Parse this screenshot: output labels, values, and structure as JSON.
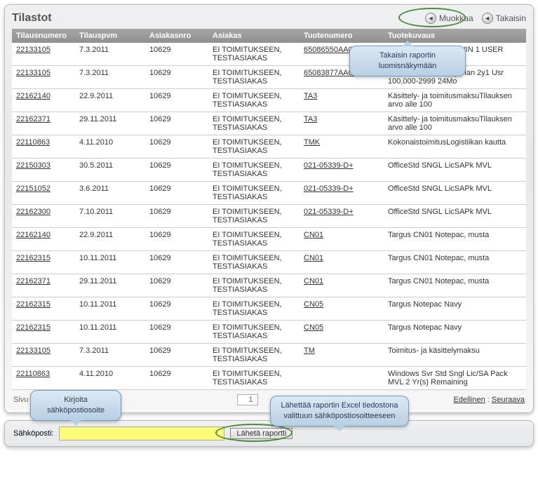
{
  "title": "Tilastot",
  "toolbar": {
    "edit": "Muokkaa",
    "back": "Takaisin"
  },
  "columns": {
    "ordernum": "Tilausnumero",
    "orderdate": "Tilauspvm",
    "custnum": "Asiakasnro",
    "customer": "Asiakas",
    "prodnum": "Tuotenumero",
    "proddesc": "Tuotekuvaus"
  },
  "rows": [
    {
      "ordernum": "22133105",
      "orderdate": "7.3.2011",
      "custnum": "10629",
      "customer": "EI TOIMITUKSEEN, TESTIASIAKAS",
      "prodnum": "65086550AA02A00",
      "proddesc": "Acrobat 10 SF AOO WIN 1 USER"
    },
    {
      "ordernum": "22133105",
      "orderdate": "7.3.2011",
      "custnum": "10629",
      "customer": "EI TOIMITUKSEEN, TESTIASIAKAS",
      "prodnum": "65083877AA02A24",
      "proddesc": "Acrobat FI New Upg Plan 2y1 Usr 100,000-2999 24Mo"
    },
    {
      "ordernum": "22162140",
      "orderdate": "22.9.2011",
      "custnum": "10629",
      "customer": "EI TOIMITUKSEEN, TESTIASIAKAS",
      "prodnum": "TA3",
      "proddesc": "Käsittely- ja toimitusmaksuTilauksen arvo alle 100"
    },
    {
      "ordernum": "22162371",
      "orderdate": "29.11.2011",
      "custnum": "10629",
      "customer": "EI TOIMITUKSEEN, TESTIASIAKAS",
      "prodnum": "TA3",
      "proddesc": "Käsittely- ja toimitusmaksuTilauksen arvo alle 100"
    },
    {
      "ordernum": "22110863",
      "orderdate": "4.11.2010",
      "custnum": "10629",
      "customer": "EI TOIMITUKSEEN, TESTIASIAKAS",
      "prodnum": "TMK",
      "proddesc": "KokonaistoimitusLogistiikan kautta"
    },
    {
      "ordernum": "22150303",
      "orderdate": "30.5.2011",
      "custnum": "10629",
      "customer": "EI TOIMITUKSEEN, TESTIASIAKAS",
      "prodnum": "021-05339-D+",
      "proddesc": "OfficeStd SNGL LicSAPk MVL"
    },
    {
      "ordernum": "22151052",
      "orderdate": "3.6.2011",
      "custnum": "10629",
      "customer": "EI TOIMITUKSEEN, TESTIASIAKAS",
      "prodnum": "021-05339-D+",
      "proddesc": "OfficeStd SNGL LicSAPk MVL"
    },
    {
      "ordernum": "22162300",
      "orderdate": "7.10.2011",
      "custnum": "10629",
      "customer": "EI TOIMITUKSEEN, TESTIASIAKAS",
      "prodnum": "021-05339-D+",
      "proddesc": "OfficeStd SNGL LicSAPk MVL"
    },
    {
      "ordernum": "22162140",
      "orderdate": "22.9.2011",
      "custnum": "10629",
      "customer": "EI TOIMITUKSEEN, TESTIASIAKAS",
      "prodnum": "CN01",
      "proddesc": "Targus CN01 Notepac, musta"
    },
    {
      "ordernum": "22162315",
      "orderdate": "10.11.2011",
      "custnum": "10629",
      "customer": "EI TOIMITUKSEEN, TESTIASIAKAS",
      "prodnum": "CN01",
      "proddesc": "Targus CN01 Notepac, musta"
    },
    {
      "ordernum": "22162371",
      "orderdate": "29.11.2011",
      "custnum": "10629",
      "customer": "EI TOIMITUKSEEN, TESTIASIAKAS",
      "prodnum": "CN01",
      "proddesc": "Targus CN01 Notepac, musta"
    },
    {
      "ordernum": "22162315",
      "orderdate": "10.11.2011",
      "custnum": "10629",
      "customer": "EI TOIMITUKSEEN, TESTIASIAKAS",
      "prodnum": "CN05",
      "proddesc": "Targus Notepac Navy"
    },
    {
      "ordernum": "22162315",
      "orderdate": "10.11.2011",
      "custnum": "10629",
      "customer": "EI TOIMITUKSEEN, TESTIASIAKAS",
      "prodnum": "CN05",
      "proddesc": "Targus Notepac Navy"
    },
    {
      "ordernum": "22133105",
      "orderdate": "7.3.2011",
      "custnum": "10629",
      "customer": "EI TOIMITUKSEEN, TESTIASIAKAS",
      "prodnum": "TM",
      "proddesc": "Toimitus- ja käsittelymaksu"
    },
    {
      "ordernum": "22110863",
      "orderdate": "4.11.2010",
      "custnum": "10629",
      "customer": "EI TOIMITUKSEEN, TESTIASIAKAS",
      "prodnum": "",
      "proddesc": "Windows Svr Std Sngl Lic/SA Pack MVL 2 Yr(s) Remaining"
    }
  ],
  "pager": {
    "label": "Sivu 1/2",
    "page": "1",
    "prev": "Edellinen",
    "next": "Seuraava"
  },
  "email": {
    "label": "Sähköposti:",
    "value": "",
    "send": "Lähetä raportti"
  },
  "callouts": {
    "editTip": "Takaisin raportin luomisnäkymään",
    "emailTip": "Kirjoita sähköpostiosoite",
    "sendTip": "Lähettää raportin Excel tiedostona valittuun sähköpostiosoitteeseen"
  }
}
